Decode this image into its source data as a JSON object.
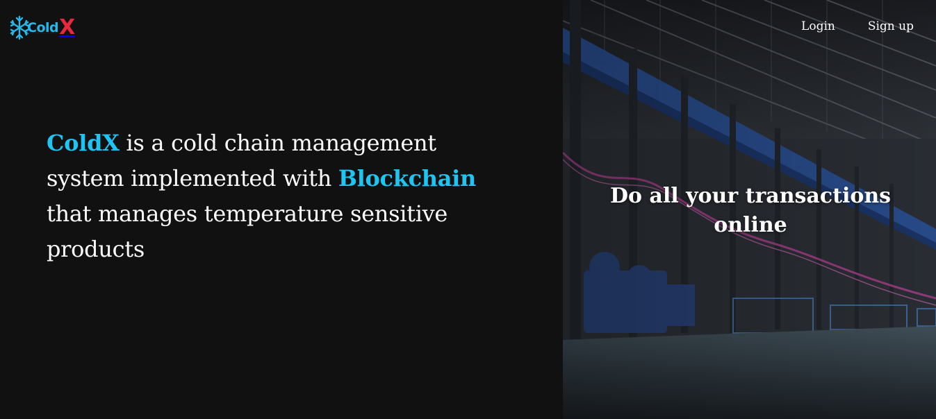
{
  "brand": {
    "logo_text_cold": "Cold",
    "logo_text_x": "X",
    "colors": {
      "cold": "#29b8e6",
      "x": "#e8283e",
      "accent": "#1fc5f2"
    }
  },
  "nav": {
    "login_label": "Login",
    "signup_label": "Sign up"
  },
  "hero": {
    "brand_word": "ColdX",
    "text_part1": " is a cold chain management system implemented with ",
    "highlight_word": "Blockchain",
    "text_part2": " that manages temperature sensitive products"
  },
  "panel": {
    "tagline": "Do all your transactions online"
  },
  "icons": [
    "snowflake-icon"
  ]
}
